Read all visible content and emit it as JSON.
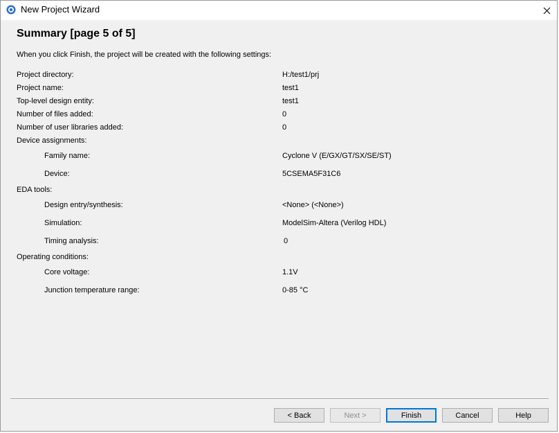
{
  "window": {
    "title": "New Project Wizard"
  },
  "page": {
    "title": "Summary [page 5 of 5]",
    "intro": "When you click Finish, the project will be created with the following settings:"
  },
  "settings": [
    {
      "label": "Project directory:",
      "value": "H:/test1/prj"
    },
    {
      "label": "Project name:",
      "value": "test1"
    },
    {
      "label": "Top-level design entity:",
      "value": "test1"
    },
    {
      "label": "Number of files added:",
      "value": "0"
    },
    {
      "label": "Number of user libraries added:",
      "value": "0"
    },
    {
      "label": "Device assignments:",
      "value": ""
    },
    {
      "label": "Family name:",
      "value": "Cyclone V (E/GX/GT/SX/SE/ST)"
    },
    {
      "label": "Device:",
      "value": "5CSEMA5F31C6"
    },
    {
      "label": "EDA tools:",
      "value": ""
    },
    {
      "label": "Design entry/synthesis:",
      "value": "<None> (<None>)"
    },
    {
      "label": "Simulation:",
      "value": "ModelSim-Altera (Verilog HDL)"
    },
    {
      "label": "Timing analysis:",
      "value": "0"
    },
    {
      "label": "Operating conditions:",
      "value": ""
    },
    {
      "label": "Core voltage:",
      "value": "1.1V"
    },
    {
      "label": "Junction temperature range:",
      "value": "0-85 °C"
    }
  ],
  "buttons": {
    "back": "< Back",
    "next": "Next >",
    "finish": "Finish",
    "cancel": "Cancel",
    "help": "Help"
  }
}
